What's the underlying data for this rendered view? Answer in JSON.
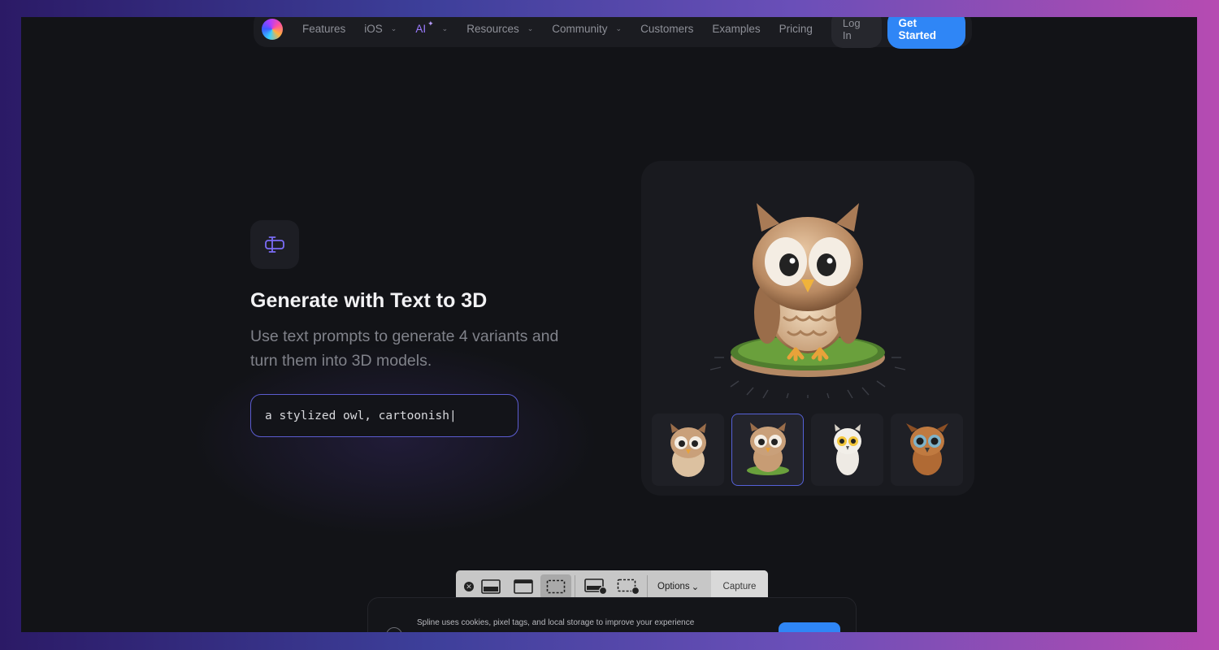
{
  "nav": {
    "items": [
      {
        "label": "Features",
        "dropdown": false
      },
      {
        "label": "iOS",
        "dropdown": true
      },
      {
        "label": "AI",
        "dropdown": true
      },
      {
        "label": "Resources",
        "dropdown": true
      },
      {
        "label": "Community",
        "dropdown": true
      },
      {
        "label": "Customers",
        "dropdown": false
      },
      {
        "label": "Examples",
        "dropdown": false
      },
      {
        "label": "Pricing",
        "dropdown": false
      }
    ],
    "login_label": "Log In",
    "get_started_label": "Get Started"
  },
  "hero": {
    "icon": "text-cursor-icon",
    "title": "Generate with Text to 3D",
    "description": "Use text prompts to generate 4 variants and turn them into 3D models.",
    "prompt_value": "a stylized owl, cartoonish|"
  },
  "preview": {
    "thumbnails": [
      {
        "name": "owl-variant-1",
        "selected": false
      },
      {
        "name": "owl-variant-2",
        "selected": true
      },
      {
        "name": "owl-variant-3",
        "selected": false
      },
      {
        "name": "owl-variant-4",
        "selected": false
      }
    ]
  },
  "capture_toolbar": {
    "options_label": "Options",
    "capture_label": "Capture"
  },
  "cookie": {
    "text": "Spline uses cookies, pixel tags, and local storage to improve your experience"
  },
  "colors": {
    "accent": "#2f86f6",
    "ai": "#9b7bff",
    "background": "#121317",
    "input_border": "#5b5ccf"
  }
}
